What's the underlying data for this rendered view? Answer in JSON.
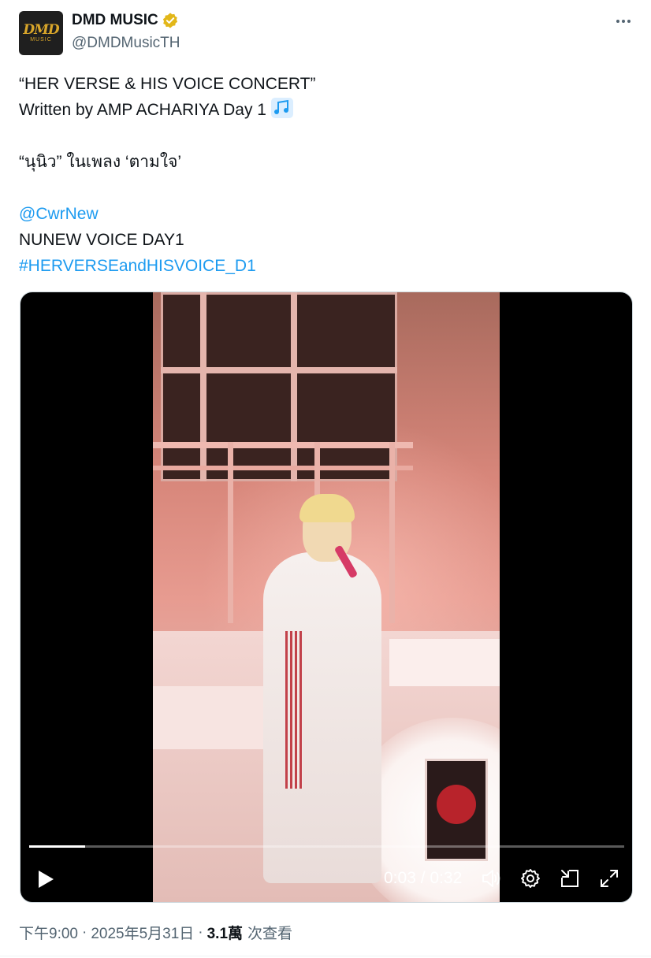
{
  "author": {
    "display_name": "DMD MUSIC",
    "handle": "@DMDMusicTH",
    "verified": true,
    "avatar_logo": "DMD",
    "avatar_sub": "MUSIC",
    "verified_color": "#e2b719"
  },
  "post": {
    "line1": "“HER VERSE & HIS VOICE CONCERT”",
    "line2": "Written by AMP ACHARIYA Day 1",
    "line2_icon": "music-notes-icon",
    "line3": "“นุนิว” ในเพลง ‘ตามใจ’",
    "mention": "@CwrNew",
    "line5": "NUNEW VOICE DAY1",
    "hashtag": "#HERVERSEandHISVOICE_D1"
  },
  "video": {
    "current_time": "0:03",
    "separator": "/",
    "duration": "0:32",
    "progress": 0.094,
    "icons": [
      "play-icon",
      "volume-icon",
      "settings-gear-icon",
      "picture-in-picture-icon",
      "fullscreen-icon"
    ]
  },
  "meta": {
    "time": "下午9:00",
    "dot1": "·",
    "date": "2025年5月31日",
    "dot2": "·",
    "views_count": "3.1萬",
    "views_label": "次查看"
  },
  "colors": {
    "link": "#1d9bf0",
    "text": "#0f1419",
    "secondary": "#536471"
  }
}
